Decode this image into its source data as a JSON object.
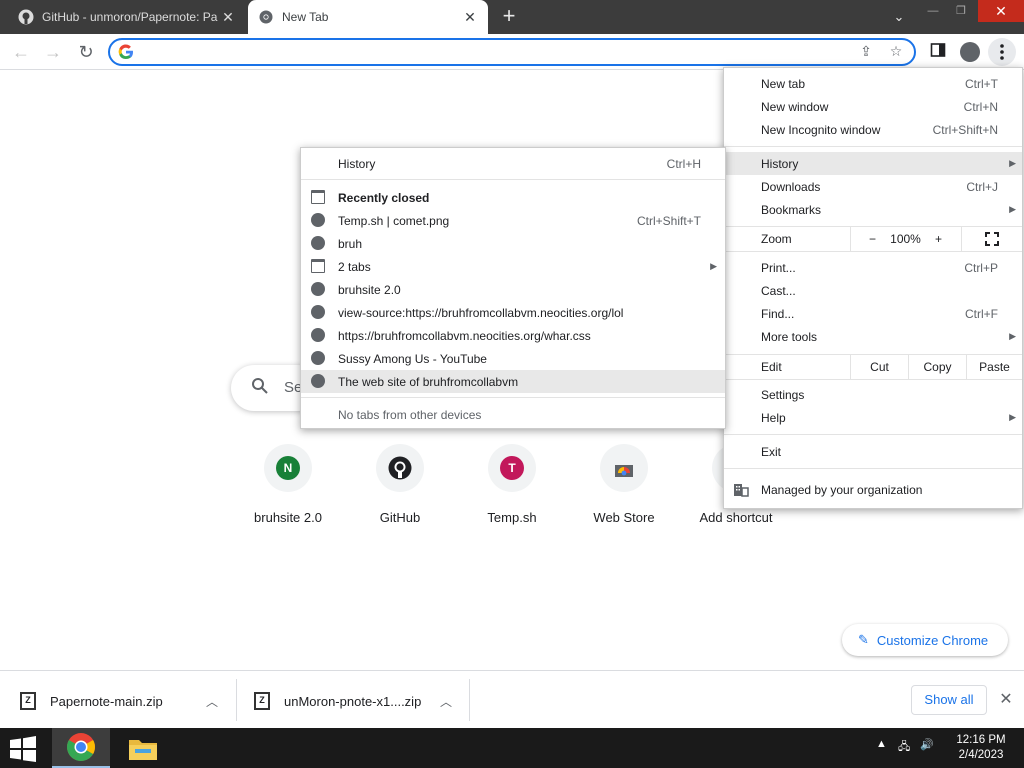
{
  "tabs": [
    {
      "title": "GitHub - unmoron/Papernote: Pa"
    },
    {
      "title": "New Tab"
    }
  ],
  "toolbar": {
    "omnibox_value": ""
  },
  "ntp": {
    "search_placeholder": "Se",
    "shortcuts": [
      {
        "label": "bruhsite 2.0",
        "letter": "N",
        "color": "#188038"
      },
      {
        "label": "GitHub",
        "letter": "",
        "color": "#202124"
      },
      {
        "label": "Temp.sh",
        "letter": "T",
        "color": "#c2185b"
      },
      {
        "label": "Web Store",
        "letter": "",
        "color": ""
      },
      {
        "label": "Add shortcut",
        "letter": "",
        "color": ""
      }
    ],
    "customize_label": "Customize Chrome"
  },
  "main_menu": {
    "new_tab": {
      "label": "New tab",
      "shortcut": "Ctrl+T"
    },
    "new_window": {
      "label": "New window",
      "shortcut": "Ctrl+N"
    },
    "new_incognito": {
      "label": "New Incognito window",
      "shortcut": "Ctrl+Shift+N"
    },
    "history": {
      "label": "History"
    },
    "downloads": {
      "label": "Downloads",
      "shortcut": "Ctrl+J"
    },
    "bookmarks": {
      "label": "Bookmarks"
    },
    "zoom": {
      "label": "Zoom",
      "minus": "−",
      "level": "100%",
      "plus": "+"
    },
    "print": {
      "label": "Print...",
      "shortcut": "Ctrl+P"
    },
    "cast": {
      "label": "Cast..."
    },
    "find": {
      "label": "Find...",
      "shortcut": "Ctrl+F"
    },
    "more_tools": {
      "label": "More tools"
    },
    "edit": {
      "label": "Edit",
      "cut": "Cut",
      "copy": "Copy",
      "paste": "Paste"
    },
    "settings": {
      "label": "Settings"
    },
    "help": {
      "label": "Help"
    },
    "exit": {
      "label": "Exit"
    },
    "managed": {
      "label": "Managed by your organization"
    }
  },
  "history_menu": {
    "history": {
      "label": "History",
      "shortcut": "Ctrl+H"
    },
    "recently_closed": "Recently closed",
    "items": [
      {
        "label": "Temp.sh | comet.png",
        "shortcut": "Ctrl+Shift+T",
        "icon": "globe"
      },
      {
        "label": "bruh",
        "shortcut": "",
        "icon": "globe"
      },
      {
        "label": "2 tabs",
        "shortcut": "",
        "icon": "window"
      },
      {
        "label": "bruhsite 2.0",
        "shortcut": "",
        "icon": "globe"
      },
      {
        "label": "view-source:https://bruhfromcollabvm.neocities.org/lol",
        "shortcut": "",
        "icon": "globe"
      },
      {
        "label": "https://bruhfromcollabvm.neocities.org/whar.css",
        "shortcut": "",
        "icon": "globe"
      },
      {
        "label": "Sussy Among Us - YouTube",
        "shortcut": "",
        "icon": "globe"
      },
      {
        "label": "The web site of bruhfromcollabvm",
        "shortcut": "",
        "icon": "globe"
      }
    ],
    "no_tabs": "No tabs from other devices"
  },
  "downloads": [
    {
      "filename": "Papernote-main.zip"
    },
    {
      "filename": "unMoron-pnote-x1....zip"
    }
  ],
  "show_all_label": "Show all",
  "taskbar": {
    "time": "12:16 PM",
    "date": "2/4/2023"
  }
}
